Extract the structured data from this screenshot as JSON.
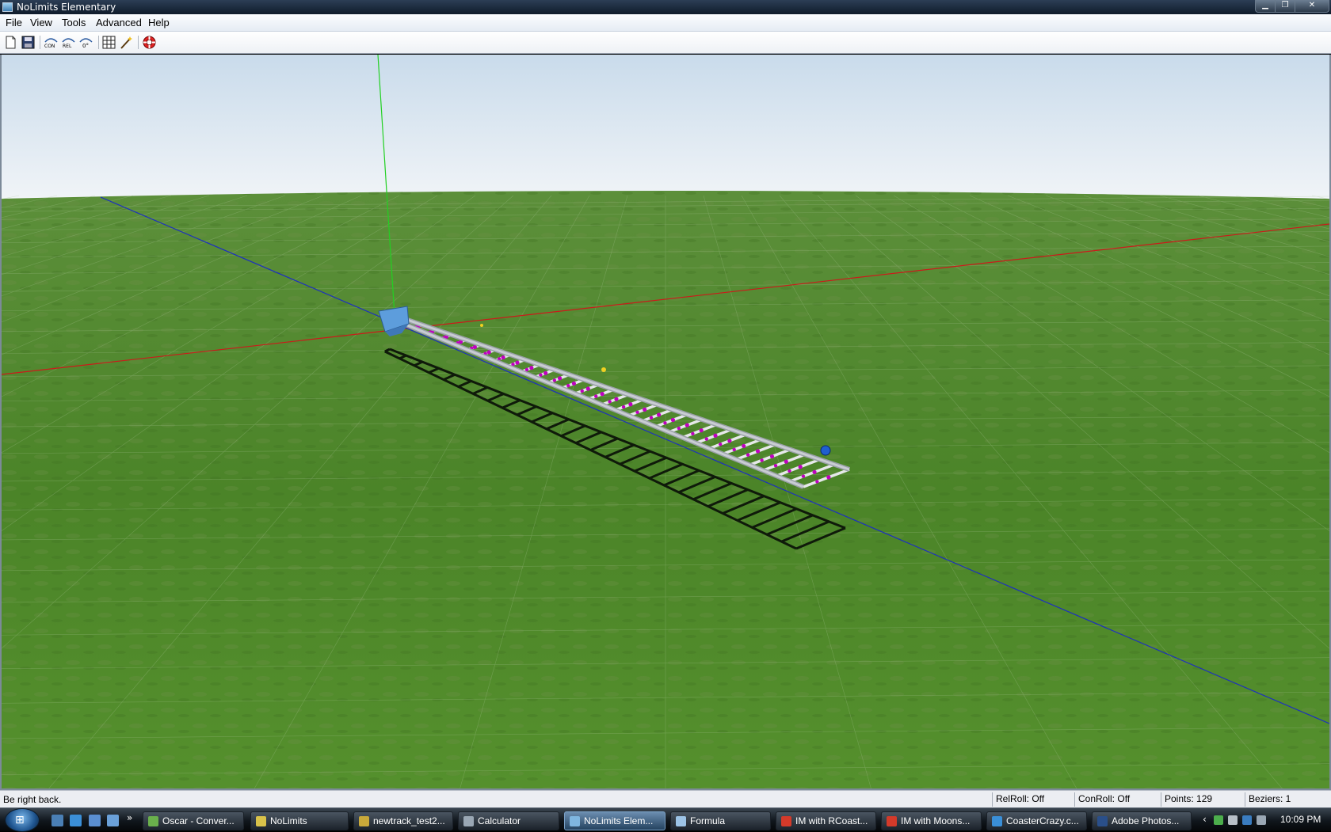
{
  "window": {
    "title": "NoLimits Elementary"
  },
  "menu": {
    "items": [
      "File",
      "View",
      "Tools",
      "Advanced",
      "Help"
    ]
  },
  "toolbar": {
    "buttons": [
      {
        "name": "new-file-icon"
      },
      {
        "name": "save-icon"
      },
      {
        "name": "con-roll-icon",
        "label": "CON"
      },
      {
        "name": "rel-roll-icon",
        "label": "REL"
      },
      {
        "name": "zero-degree-icon",
        "label": "0°"
      },
      {
        "name": "grid-icon"
      },
      {
        "name": "wand-icon"
      },
      {
        "name": "help-lifebuoy-icon"
      }
    ]
  },
  "scene": {
    "axes_colors": {
      "x": "#cc1a1a",
      "y": "#22d022",
      "z": "#1d2fc0"
    },
    "sky_top": "#cfe0ee",
    "sky_bottom": "#eef3f8",
    "ground": "#4f8a2c",
    "track_color": "#c8ccd2",
    "node_color": "#c000c0"
  },
  "status": {
    "message": "Be right back.",
    "relroll": "RelRoll: Off",
    "conroll": "ConRoll: Off",
    "points": "Points: 129",
    "beziers": "Beziers: 1"
  },
  "taskbar": {
    "tasks": [
      {
        "label": "Oscar - Conver...",
        "icon": "#6ab04c"
      },
      {
        "label": "NoLimits",
        "icon": "#d9c24a"
      },
      {
        "label": "newtrack_test2...",
        "icon": "#c9a93a"
      },
      {
        "label": "Calculator",
        "icon": "#9aa7b4"
      },
      {
        "label": "NoLimits Elem...",
        "icon": "#7fb6e0",
        "active": true
      },
      {
        "label": "Formula",
        "icon": "#9cc3e6"
      },
      {
        "label": "IM with RCoast...",
        "icon": "#d43a2a"
      },
      {
        "label": "IM with Moons...",
        "icon": "#d43a2a"
      },
      {
        "label": "CoasterCrazy.c...",
        "icon": "#3a8fd8"
      },
      {
        "label": "Adobe Photos...",
        "icon": "#2a4f8a"
      }
    ],
    "clock": "10:09 PM"
  }
}
